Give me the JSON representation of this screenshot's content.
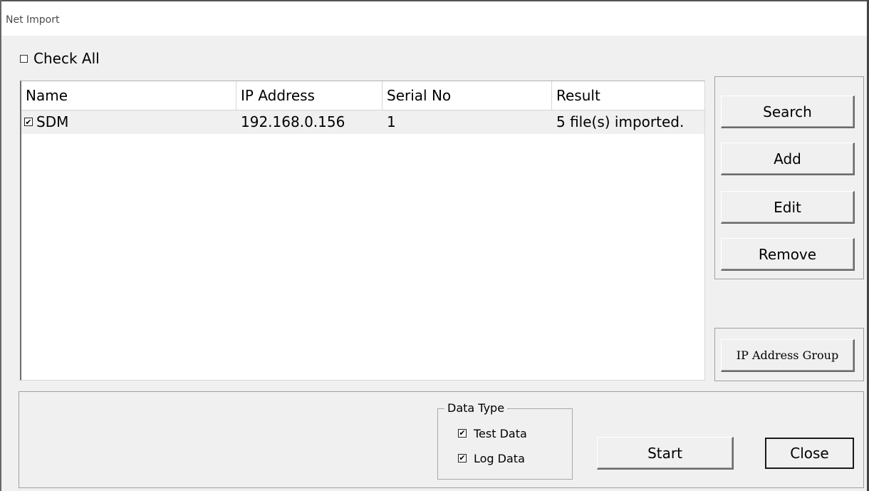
{
  "window": {
    "title": "Net Import"
  },
  "check_all": {
    "label": "Check All",
    "checked": false,
    "check_glyph": ""
  },
  "list": {
    "columns": [
      "Name",
      "IP Address",
      "Serial No",
      "Result"
    ],
    "rows": [
      {
        "checked": true,
        "check_glyph": "✔",
        "name": "SDM",
        "ip": "192.168.0.156",
        "serial": "1",
        "result": "5 file(s) imported."
      }
    ]
  },
  "side_buttons": {
    "search": "Search",
    "add": "Add",
    "edit": "Edit",
    "remove": "Remove",
    "ip_group": "IP Address Group"
  },
  "data_type": {
    "title": "Data Type",
    "test_data": {
      "label": "Test Data",
      "checked": true,
      "check_glyph": "✔"
    },
    "log_data": {
      "label": "Log Data",
      "checked": true,
      "check_glyph": "✔"
    }
  },
  "actions": {
    "start": "Start",
    "close": "Close"
  }
}
